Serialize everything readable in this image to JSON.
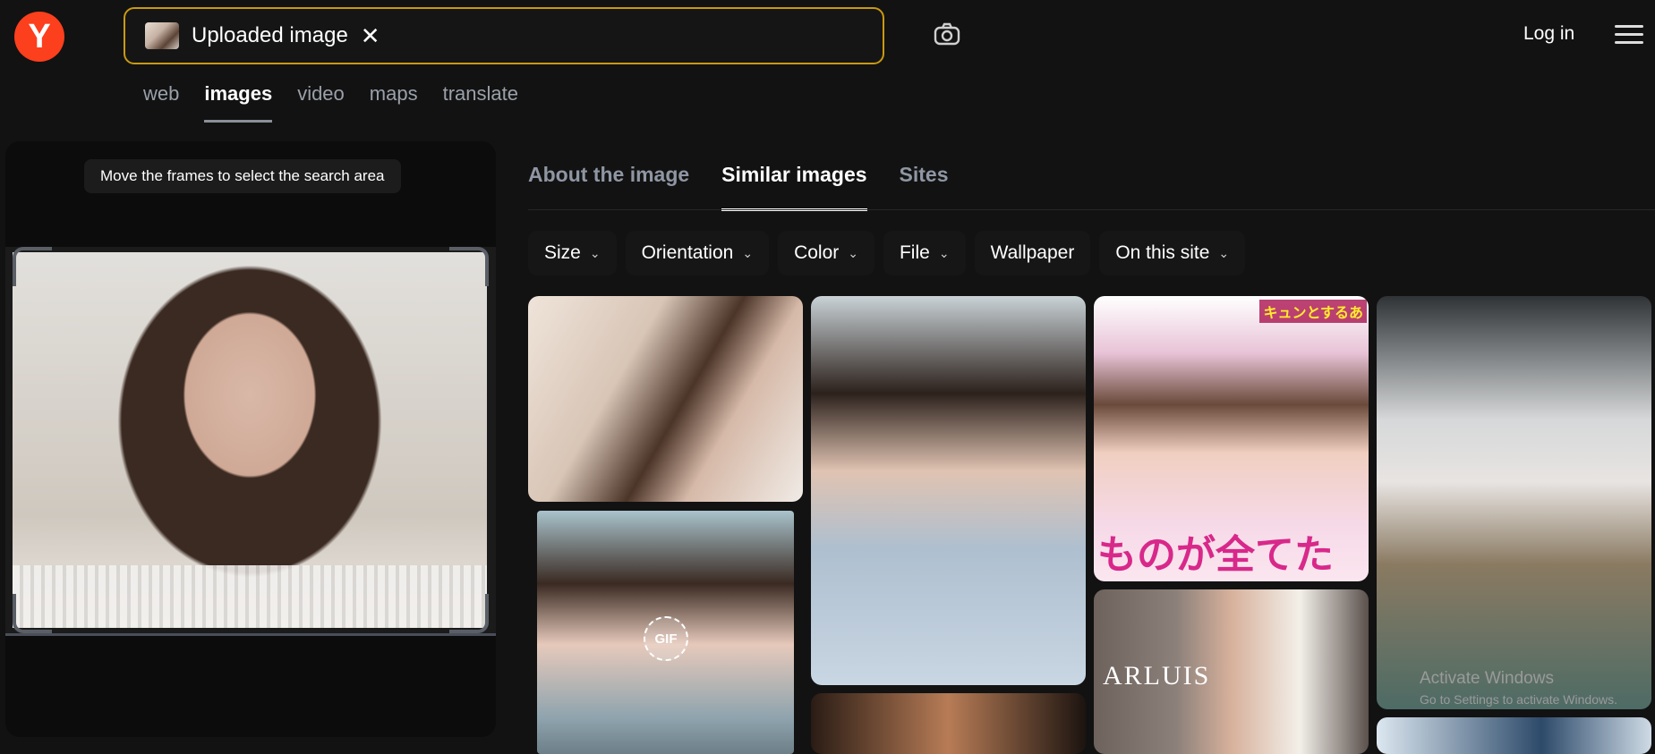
{
  "header": {
    "logo_letter": "Y",
    "search_label": "Uploaded image",
    "clear_symbol": "✕",
    "login_label": "Log in"
  },
  "nav": {
    "items": [
      {
        "label": "web",
        "active": false
      },
      {
        "label": "images",
        "active": true
      },
      {
        "label": "video",
        "active": false
      },
      {
        "label": "maps",
        "active": false
      },
      {
        "label": "translate",
        "active": false
      }
    ]
  },
  "preview": {
    "hint": "Move the frames to select the search area"
  },
  "tabs": [
    {
      "label": "About the image",
      "active": false
    },
    {
      "label": "Similar images",
      "active": true
    },
    {
      "label": "Sites",
      "active": false
    }
  ],
  "filters": [
    {
      "label": "Size",
      "has_dropdown": true
    },
    {
      "label": "Orientation",
      "has_dropdown": true
    },
    {
      "label": "Color",
      "has_dropdown": true
    },
    {
      "label": "File",
      "has_dropdown": true
    },
    {
      "label": "Wallpaper",
      "has_dropdown": false
    },
    {
      "label": "On this site",
      "has_dropdown": true
    }
  ],
  "results": {
    "gif_badge": "GIF",
    "jp_caption": "ものが全てた",
    "jp_top_caption": "キュンとするあ",
    "wedding_caption": "ARLUIS"
  },
  "watermark": {
    "title": "Activate Windows",
    "subtitle": "Go to Settings to activate Windows."
  },
  "colors": {
    "background": "#121212",
    "logo": "#fc3f1d",
    "search_border": "#c89a11",
    "active_text": "#ffffff",
    "inactive_text": "#8f96a3"
  },
  "icons": {
    "camera": "camera-icon",
    "menu": "hamburger-menu-icon",
    "chevron": "chevron-down-icon"
  }
}
